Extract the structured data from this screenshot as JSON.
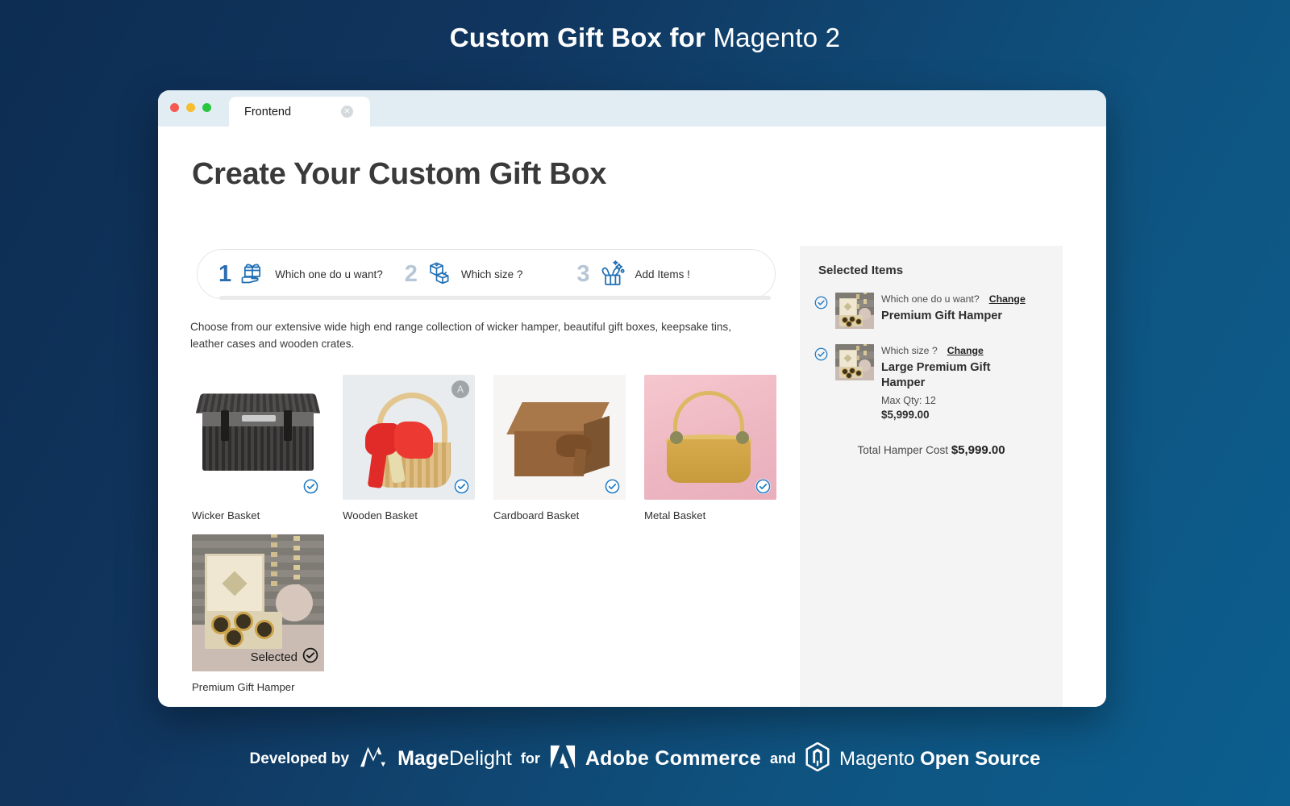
{
  "banner": {
    "title_bold": "Custom Gift Box for",
    "title_regular": "Magento 2"
  },
  "browser": {
    "tab_label": "Frontend",
    "tab_close_icon": "close-icon",
    "traffic_lights": [
      "red",
      "yellow",
      "green"
    ]
  },
  "page": {
    "title": "Create Your Custom Gift Box",
    "description": "Choose from our extensive wide high end range collection of wicker hamper, beautiful gift boxes, keepsake tins, leather cases and wooden crates."
  },
  "steps": [
    {
      "number": "1",
      "label": "Which one do u want?",
      "icon": "gift-on-hand-icon",
      "state": "active"
    },
    {
      "number": "2",
      "label": "Which size ?",
      "icon": "stacked-gift-boxes-icon",
      "state": "idle"
    },
    {
      "number": "3",
      "label": "Add Items !",
      "icon": "gift-with-sparkles-icon",
      "state": "idle"
    }
  ],
  "products": [
    {
      "name": "Wicker Basket",
      "selected": false,
      "badge_icon": "check-circle-icon"
    },
    {
      "name": "Wooden Basket",
      "selected": false,
      "badge_icon": "check-circle-icon"
    },
    {
      "name": "Cardboard Basket",
      "selected": false,
      "badge_icon": "check-circle-icon"
    },
    {
      "name": "Metal Basket",
      "selected": false,
      "badge_icon": "check-circle-icon"
    },
    {
      "name": "Premium Gift Hamper",
      "selected": true,
      "selected_label": "Selected",
      "badge_icon": "check-circle-filled-icon"
    }
  ],
  "sidebar": {
    "title": "Selected Items",
    "items": [
      {
        "question": "Which one do u want?",
        "change_label": "Change",
        "name": "Premium Gift Hamper",
        "check_icon": "check-circle-icon"
      },
      {
        "question": "Which size ?",
        "change_label": "Change",
        "name": "Large Premium Gift Hamper",
        "max_qty": "Max Qty: 12",
        "price": "$5,999.00",
        "check_icon": "check-circle-icon"
      }
    ],
    "total_label": "Total Hamper Cost",
    "total_value": "$5,999.00"
  },
  "footer": {
    "developed_by": "Developed by",
    "mage_bold": "Mage",
    "mage_light": "Delight",
    "for": "for",
    "adobe": "Adobe Commerce",
    "and": "and",
    "magento_light": "Magento",
    "magento_bold": "Open Source",
    "magedelight_icon": "magedelight-logo-icon",
    "adobe_icon": "adobe-logo-icon",
    "magento_icon": "magento-logo-icon"
  },
  "colors": {
    "accent_blue": "#2b6cb0",
    "banner_start": "#0d2d52",
    "banner_end": "#0b5e8e",
    "check_blue": "#1f7ac4"
  }
}
